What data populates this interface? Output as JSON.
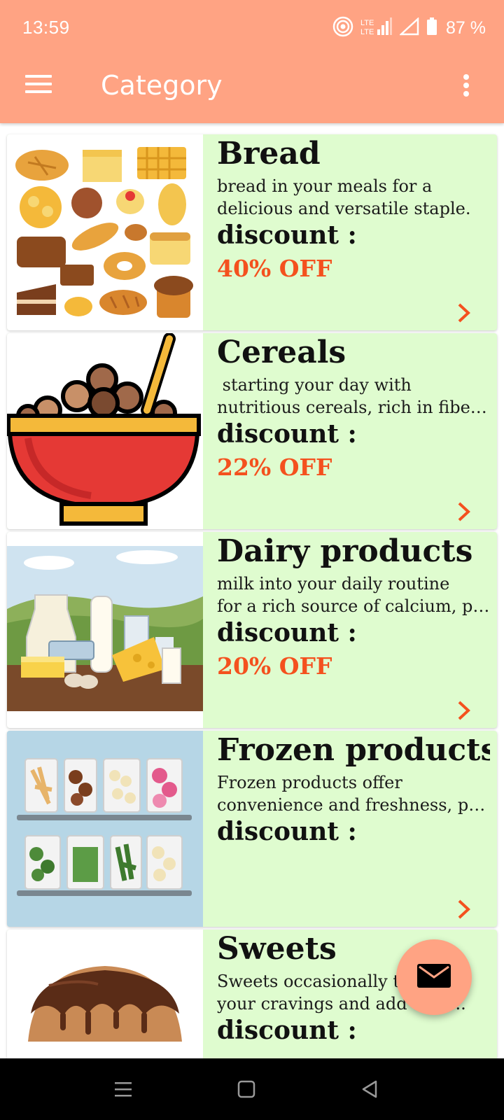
{
  "status_bar": {
    "time": "13:59",
    "battery": "87 %",
    "icons": [
      "hotspot-icon",
      "lte-signal-icon",
      "wifi-signal-icon",
      "battery-icon"
    ]
  },
  "app_bar": {
    "title": "Category",
    "menu_icon": "hamburger-menu-icon",
    "overflow_icon": "more-vert-icon"
  },
  "categories": [
    {
      "title": "Bread",
      "desc_lines": [
        "bread in your meals for a",
        "delicious and versatile staple."
      ],
      "discount_label": "discount :",
      "discount_value": "40% OFF"
    },
    {
      "title": "Cereals",
      "desc_lines": [
        " starting your day with",
        "nutritious cereals, rich in fiber..."
      ],
      "discount_label": "discount :",
      "discount_value": "22% OFF"
    },
    {
      "title": "Dairy products",
      "desc_lines": [
        "milk into your daily routine",
        "for a rich source of calcium, pr..."
      ],
      "discount_label": "discount :",
      "discount_value": "20% OFF"
    },
    {
      "title": "Frozen products",
      "desc_lines": [
        "Frozen products offer",
        "convenience and freshness, pr..."
      ],
      "discount_label": "discount :",
      "discount_value": ""
    },
    {
      "title": "Sweets",
      "desc_lines": [
        "Sweets occasionally to",
        "your cravings and add ... n ..."
      ],
      "discount_label": "discount :",
      "discount_value": ""
    }
  ],
  "fab": {
    "icon": "email-icon"
  },
  "nav_bar": {
    "icons": [
      "recents-icon",
      "home-icon",
      "back-icon"
    ]
  },
  "colors": {
    "primary": "#FFA383",
    "card_bg": "#DFFCCF",
    "accent": "#F4511E"
  }
}
